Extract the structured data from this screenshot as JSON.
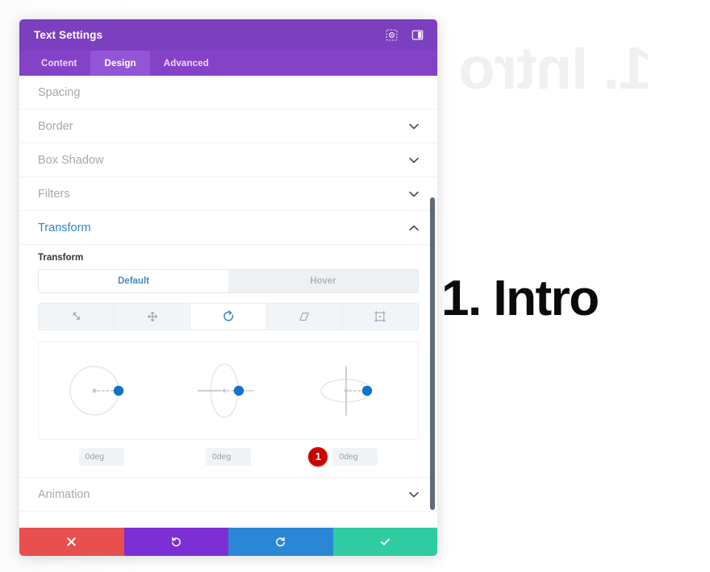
{
  "canvas": {
    "ghost_heading": "1. Intro",
    "main_heading": "1. Intro"
  },
  "panel": {
    "title": "Text Settings",
    "header_icons": [
      {
        "name": "focus-target-icon",
        "label": "Focus"
      },
      {
        "name": "panel-layout-icon",
        "label": "Layout"
      }
    ],
    "tabs": [
      {
        "label": "Content",
        "active": false
      },
      {
        "label": "Design",
        "active": true
      },
      {
        "label": "Advanced",
        "active": false
      }
    ],
    "sections": [
      {
        "label": "Spacing",
        "open": false
      },
      {
        "label": "Border",
        "open": false
      },
      {
        "label": "Box Shadow",
        "open": false
      },
      {
        "label": "Filters",
        "open": false
      },
      {
        "label": "Transform",
        "open": true
      },
      {
        "label": "Animation",
        "open": false
      }
    ],
    "transform": {
      "field_label": "Transform",
      "states": [
        {
          "label": "Default",
          "active": true
        },
        {
          "label": "Hover",
          "active": false
        }
      ],
      "types": [
        {
          "name": "scale-icon",
          "label": "Scale",
          "active": false
        },
        {
          "name": "translate-move-icon",
          "label": "Move",
          "active": false
        },
        {
          "name": "rotate-icon",
          "label": "Rotate",
          "active": true
        },
        {
          "name": "skew-icon",
          "label": "Skew",
          "active": false
        },
        {
          "name": "transform-origin-icon",
          "label": "Origin",
          "active": false
        }
      ],
      "dials": [
        {
          "axis": "z",
          "name": "rotate-z-dial",
          "value": "0deg"
        },
        {
          "axis": "y",
          "name": "rotate-y-dial",
          "value": "0deg"
        },
        {
          "axis": "x",
          "name": "rotate-x-dial",
          "value": "0deg"
        }
      ],
      "step_badge": "1"
    },
    "footer": [
      {
        "name": "cancel-button",
        "icon": "close-icon",
        "color": "#E8504F"
      },
      {
        "name": "undo-button",
        "icon": "undo-icon",
        "color": "#7B2FD4"
      },
      {
        "name": "redo-button",
        "icon": "redo-icon",
        "color": "#2B87D6"
      },
      {
        "name": "save-button",
        "icon": "check-icon",
        "color": "#2ECCA0"
      }
    ],
    "scrollbar": {
      "thumb_top_pct": 27,
      "thumb_height_pct": 69
    }
  },
  "colors": {
    "header_purple": "#7B3FBF",
    "tabbar_purple": "#8542C9",
    "accent_blue": "#2B87D6",
    "badge_red": "#cc0000"
  }
}
